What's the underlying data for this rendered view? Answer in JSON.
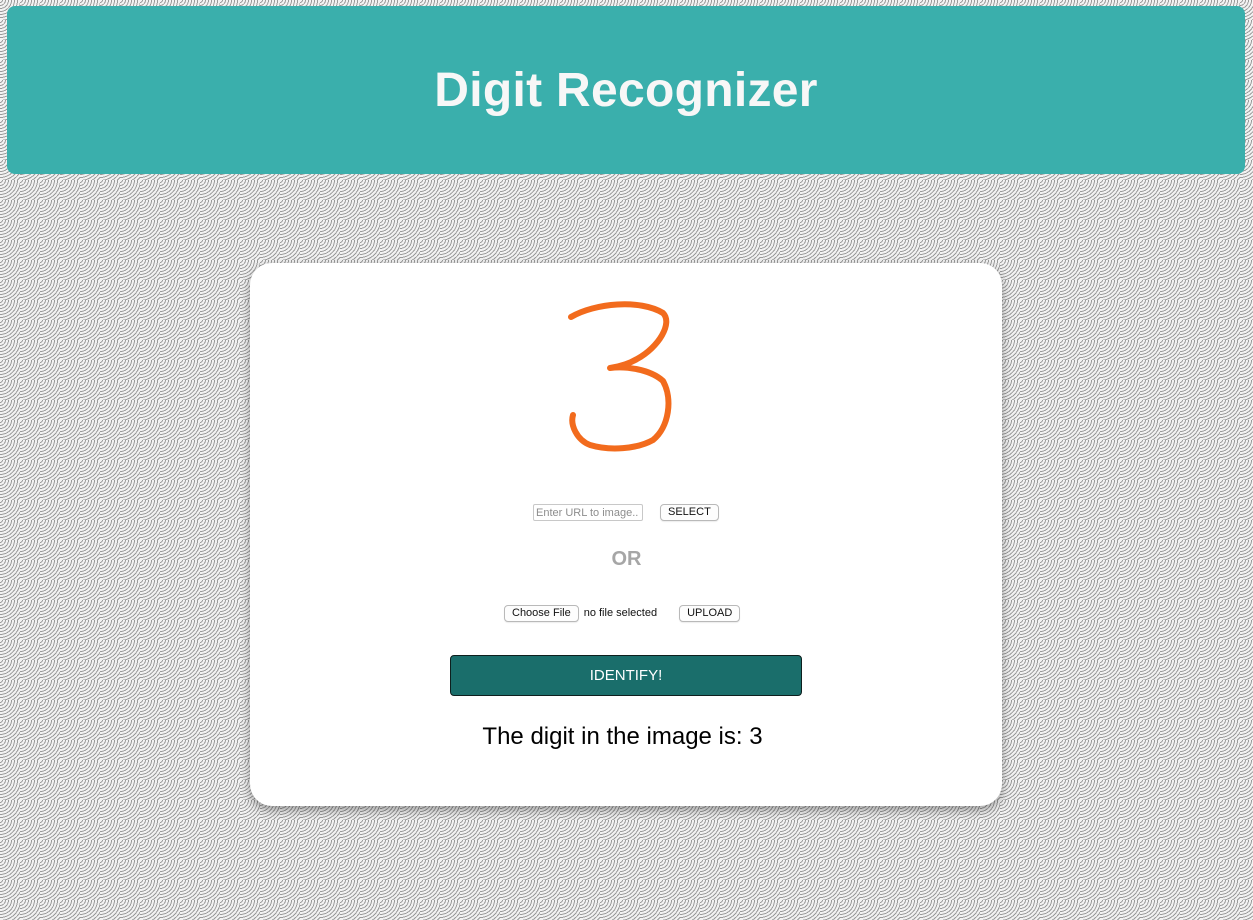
{
  "header": {
    "title": "Digit Recognizer",
    "background_color": "#3aafac"
  },
  "preview": {
    "digit_shown": "3",
    "stroke_color": "#f26b1d"
  },
  "url_form": {
    "placeholder": "Enter URL to image..",
    "value": "",
    "select_label": "SELECT"
  },
  "separator": {
    "text": "OR"
  },
  "file_form": {
    "choose_label": "Choose File",
    "status": "no file selected",
    "upload_label": "UPLOAD"
  },
  "identify": {
    "label": "IDENTIFY!",
    "color": "#1a6e6b"
  },
  "result": {
    "text": "The digit in the image is: 3"
  }
}
